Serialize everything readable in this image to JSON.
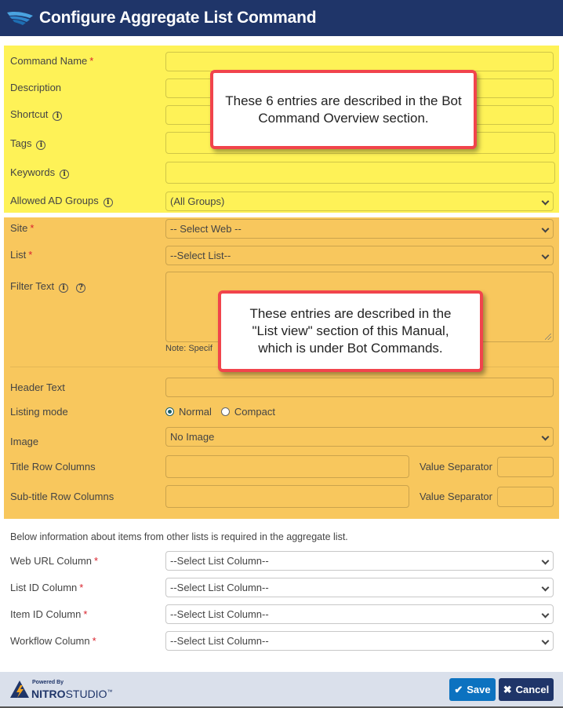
{
  "header": {
    "title": "Configure Aggregate List Command",
    "logo_icon": "wing-logo-icon"
  },
  "general": {
    "command_name": {
      "label": "Command Name",
      "required": "*",
      "value": ""
    },
    "description": {
      "label": "Description",
      "value": ""
    },
    "shortcut": {
      "label": "Shortcut",
      "info": "i",
      "value": ""
    },
    "tags": {
      "label": "Tags",
      "info": "i",
      "value": ""
    },
    "keywords": {
      "label": "Keywords",
      "info": "i",
      "value": ""
    },
    "allowed_ad_groups": {
      "label": "Allowed AD Groups",
      "info": "i",
      "value": "(All Groups)"
    }
  },
  "list_view": {
    "site": {
      "label": "Site",
      "required": "*",
      "value": "-- Select Web --"
    },
    "list": {
      "label": "List",
      "required": "*",
      "value": "--Select List--"
    },
    "filter_text": {
      "label": "Filter Text",
      "info": "i",
      "help": "?",
      "value": "",
      "note": "Note: Specif"
    },
    "header_text": {
      "label": "Header Text",
      "value": ""
    },
    "listing_mode": {
      "label": "Listing mode",
      "options": [
        "Normal",
        "Compact"
      ],
      "selected": "Normal"
    },
    "image": {
      "label": "Image",
      "value": "No Image"
    },
    "title_row_columns": {
      "label": "Title Row Columns",
      "value": "",
      "separator_label": "Value Separator",
      "separator_value": ""
    },
    "subtitle_row_columns": {
      "label": "Sub-title Row Columns",
      "value": "",
      "separator_label": "Value Separator",
      "separator_value": ""
    }
  },
  "aggregate": {
    "info": "Below information about items from other lists is required in the aggregate list.",
    "web_url_column": {
      "label": "Web URL Column",
      "required": "*",
      "value": "--Select List Column--"
    },
    "list_id_column": {
      "label": "List ID Column",
      "required": "*",
      "value": "--Select List Column--"
    },
    "item_id_column": {
      "label": "Item ID Column",
      "required": "*",
      "value": "--Select List Column--"
    },
    "workflow_column": {
      "label": "Workflow Column",
      "required": "*",
      "value": "--Select List Column--"
    }
  },
  "callouts": {
    "general": "These 6 entries are described in the Bot Command Overview section.",
    "list_view": "These entries are described in the \"List view\" section of this Manual, which is under Bot Commands."
  },
  "footer": {
    "powered_by": "Powered By",
    "brand_bold": "NITRO",
    "brand_light": "STUDIO",
    "trademark": "™",
    "save_label": "Save",
    "cancel_label": "Cancel"
  },
  "colors": {
    "header_bg": "#1f3569",
    "yellow_highlight": "#fef257",
    "orange_highlight": "#f8c75d",
    "callout_border": "#f1444c",
    "save_bg": "#0c72c0",
    "cancel_bg": "#1f3569",
    "required": "#d9232d"
  }
}
